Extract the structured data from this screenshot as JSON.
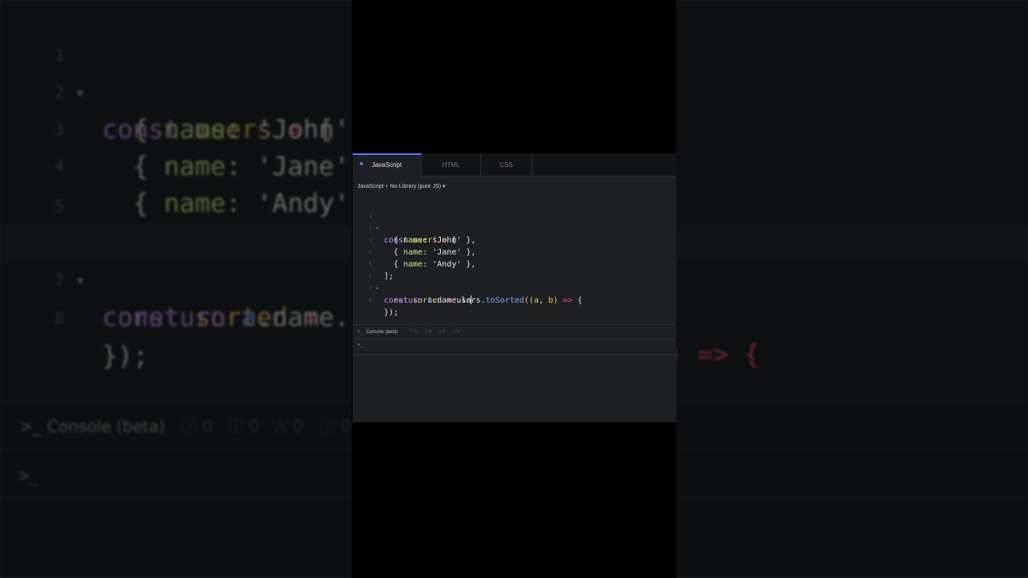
{
  "tabs": [
    {
      "label": "JavaScript",
      "active": true
    },
    {
      "label": "HTML",
      "active": false
    },
    {
      "label": "CSS",
      "active": false
    }
  ],
  "library_select": {
    "label": "JavaScript + No-Library (pure JS)",
    "arrow": "▾"
  },
  "code_lines": [
    {
      "num": "1",
      "fold": "▾"
    },
    {
      "num": "2",
      "fold": ""
    },
    {
      "num": "3",
      "fold": ""
    },
    {
      "num": "4",
      "fold": ""
    },
    {
      "num": "5",
      "fold": ""
    },
    {
      "num": "6",
      "fold": "▾"
    },
    {
      "num": "7",
      "fold": ""
    },
    {
      "num": "8",
      "fold": ""
    }
  ],
  "code": {
    "l1": {
      "kw": "const",
      "var": "users",
      "op": "=",
      "pun": "["
    },
    "l2": {
      "open": "{",
      "prop": "name:",
      "str": "'John'",
      "close": "},"
    },
    "l3": {
      "open": "{",
      "prop": "name:",
      "str": "'Jane'",
      "close": "},"
    },
    "l4": {
      "open": "{",
      "prop": "name:",
      "str": "'Andy'",
      "close": "},"
    },
    "l5": {
      "pun": "];"
    },
    "l6": {
      "kw": "const",
      "var": "sorted",
      "op": "=",
      "obj": "users.",
      "fn": "toSorted",
      "p1": "((",
      "a": "a",
      "comma": ",",
      "b": "b",
      "p2": ")",
      "arrow": "=>",
      "brace": "{"
    },
    "l7": {
      "kw": "return",
      "a": "a",
      "rest": ".name.lo"
    },
    "l8": {
      "pun": "});"
    }
  },
  "console": {
    "icon": ">_",
    "title": "Console (beta)",
    "counts": [
      "0",
      "0",
      "0",
      "0"
    ],
    "count_icons": [
      "ⓘ",
      "ⓘ",
      "⚠",
      "ⓧ"
    ],
    "prompt": ">_"
  },
  "bg": {
    "l1": {
      "num": "1",
      "fold": "▾",
      "kw": "const",
      "var": "users",
      "op": "=",
      "pun": "["
    },
    "l2": {
      "num": "2",
      "open": "{",
      "prop": "name:",
      "str": "'John'"
    },
    "l3": {
      "num": "3",
      "open": "{",
      "prop": "name:",
      "str": "'Jane'"
    },
    "l4": {
      "num": "4",
      "open": "{",
      "prop": "name:",
      "str": "'Andy'"
    },
    "l5": {
      "num": "5",
      "pun": "];"
    },
    "l6": {
      "num": "6",
      "fold": "▾",
      "kw": "const",
      "var": "sorted",
      "op": "=",
      "tail": ") => {"
    },
    "l7": {
      "num": "7",
      "kw": "return",
      "a": "a",
      "rest": ".name."
    },
    "l8": {
      "num": "8",
      "pun": "});"
    },
    "console_title": "Console (beta)",
    "console_icon": ">_",
    "counts": [
      "0",
      "0",
      "0",
      "0"
    ],
    "count_icons": [
      "ⓘ",
      "ⓘ",
      "⚠",
      "ⓘ"
    ],
    "prompt": ">_"
  }
}
